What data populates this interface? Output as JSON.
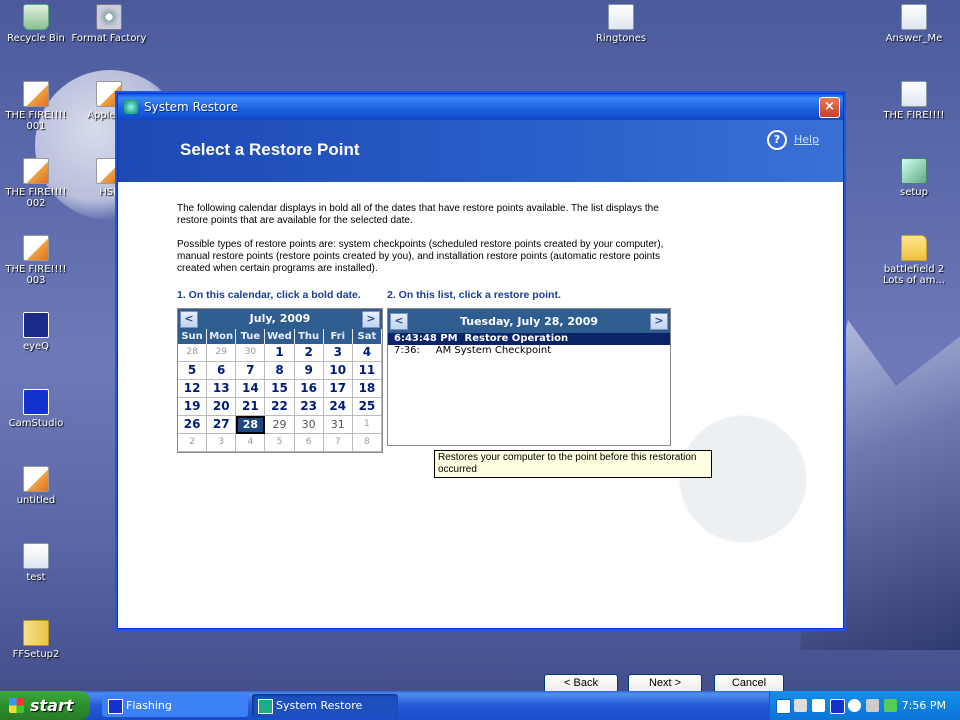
{
  "desktop": {
    "icons": [
      {
        "label": "Recycle Bin"
      },
      {
        "label": "Format Factory"
      },
      {
        "label": "Ringtones"
      },
      {
        "label": "Answer_Me"
      },
      {
        "label": "THE FIRE!!!! 001"
      },
      {
        "label": "Apple-Lo"
      },
      {
        "label": "THE FIRE!!!!"
      },
      {
        "label": "THE FIRE!!!! 002"
      },
      {
        "label": "HSF"
      },
      {
        "label": "setup"
      },
      {
        "label": "THE FIRE!!!! 003"
      },
      {
        "label": "battlefield 2 Lots of am..."
      },
      {
        "label": "eyeQ"
      },
      {
        "label": "CamStudio"
      },
      {
        "label": "untitled"
      },
      {
        "label": "test"
      },
      {
        "label": "FFSetup2"
      }
    ]
  },
  "window": {
    "title": "System Restore",
    "close": "×",
    "heading": "Select a Restore Point",
    "help": "Help",
    "help_icon": "?",
    "intro": "The following calendar displays in bold all of the dates that have restore points available. The list displays the restore points that are available for the selected date.",
    "types": "Possible types of restore points are: system checkpoints (scheduled restore points created by your computer), manual restore points (restore points created by you), and installation restore points (automatic restore points created when certain programs are installed).",
    "step1": "1. On this calendar, click a bold date.",
    "step2": "2. On this list, click a restore point.",
    "calendar": {
      "month": "July, 2009",
      "prev": "<",
      "next": ">",
      "days_of_week": [
        "Sun",
        "Mon",
        "Tue",
        "Wed",
        "Thu",
        "Fri",
        "Sat"
      ],
      "weeks": [
        [
          "28",
          "29",
          "30",
          "1",
          "2",
          "3",
          "4"
        ],
        [
          "5",
          "6",
          "7",
          "8",
          "9",
          "10",
          "11"
        ],
        [
          "12",
          "13",
          "14",
          "15",
          "16",
          "17",
          "18"
        ],
        [
          "19",
          "20",
          "21",
          "22",
          "23",
          "24",
          "25"
        ],
        [
          "26",
          "27",
          "28",
          "29",
          "30",
          "31",
          "1"
        ],
        [
          "2",
          "3",
          "4",
          "5",
          "6",
          "7",
          "8"
        ]
      ],
      "selected": "28"
    },
    "restore_list": {
      "date": "Tuesday, July 28, 2009",
      "prev": "<",
      "next": ">",
      "items": [
        {
          "time": "6:43:48 PM",
          "desc": "Restore Operation"
        },
        {
          "time": "7:36:",
          "desc": "AM  System Checkpoint"
        }
      ]
    },
    "tooltip": "Restores your computer to the point before this restoration occurred",
    "buttons": {
      "back": "< Back",
      "next": "Next >",
      "cancel": "Cancel"
    }
  },
  "taskbar": {
    "start": "start",
    "tasks": [
      {
        "label": "Flashing"
      },
      {
        "label": "System Restore"
      }
    ],
    "clock": "7:56 PM"
  }
}
